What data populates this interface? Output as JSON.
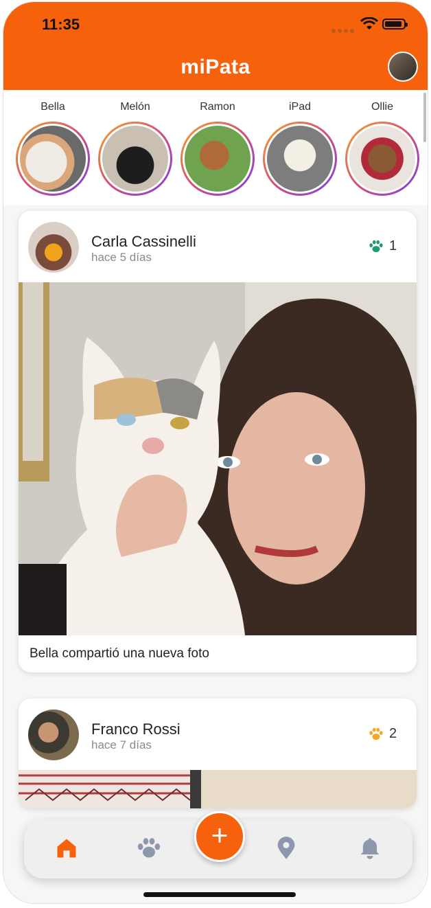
{
  "status_bar": {
    "time": "11:35"
  },
  "header": {
    "title": "miPata"
  },
  "stories": [
    {
      "name": "Bella"
    },
    {
      "name": "Melón"
    },
    {
      "name": "Ramon"
    },
    {
      "name": "iPad"
    },
    {
      "name": "Ollie"
    }
  ],
  "posts": [
    {
      "author": "Carla Cassinelli",
      "time": "hace 5 días",
      "likes": "1",
      "caption": "Bella compartió una nueva foto",
      "paw_color": "#1f9a6e"
    },
    {
      "author": "Franco Rossi",
      "time": "hace 7 días",
      "likes": "2",
      "caption": "",
      "paw_color": "#f5a623"
    }
  ],
  "bottom_nav": {
    "items": [
      {
        "icon": "home-icon",
        "active": true
      },
      {
        "icon": "paw-icon",
        "active": false
      },
      {
        "icon": "plus-icon",
        "label": "+"
      },
      {
        "icon": "location-pin-icon",
        "active": false
      },
      {
        "icon": "bell-icon",
        "active": false
      }
    ]
  },
  "colors": {
    "brand": "#f6620c",
    "nav_inactive": "#8e98ad"
  }
}
